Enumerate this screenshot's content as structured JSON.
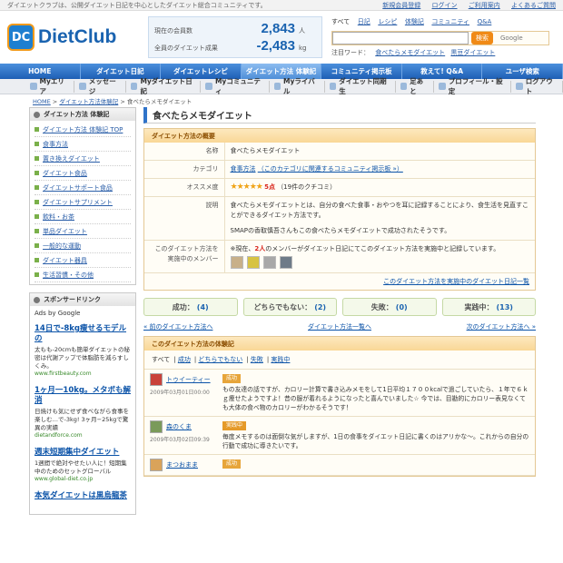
{
  "topbar": {
    "tagline": "ダイエットクラブは、公開ダイエット日記を中心としたダイエット総合コミュニティです。",
    "links": [
      "新規会員登録",
      "ログイン",
      "ご利用案内",
      "よくあるご質問"
    ]
  },
  "logo": {
    "mark": "DC",
    "name": "DietClub"
  },
  "stats": {
    "members_label": "現在の会員数",
    "members_value": "2,843",
    "members_unit": "人",
    "result_label": "全員のダイエット成果",
    "result_value": "-2,483",
    "result_unit": "kg"
  },
  "search": {
    "quick": [
      "すべて",
      "日記",
      "レシピ",
      "体験記",
      "コミュニティ",
      "Q&A"
    ],
    "placeholder": "",
    "button": "検索",
    "google": "Google",
    "popular_label": "注目ワード：",
    "popular": [
      "食べたらメモダイエット",
      "黒豆ダイエット"
    ]
  },
  "mainnav": [
    "HOME",
    "ダイエット日記",
    "ダイエットレシピ",
    "ダイエット方法 体験記",
    "コミュニティ掲示板",
    "教えて! Q&A",
    "ユーザ検索"
  ],
  "subnav": [
    "Myエリア",
    "メッセージ",
    "Myダイエット日記",
    "Myコミュニティ",
    "Myライバル",
    "ダイエット同期生",
    "足あと",
    "プロフィール・設定",
    "ログアウト"
  ],
  "breadcrumb": {
    "home": "HOME",
    "section": "ダイエット方法体験記",
    "current": "食べたらメモダイエット"
  },
  "sidebar": {
    "heading": "ダイエット方法 体験記",
    "items": [
      "ダイエット方法 体験記 TOP",
      "食事方法",
      "置き換えダイエット",
      "ダイエット食品",
      "ダイエットサポート食品",
      "ダイエットサプリメント",
      "飲料・お茶",
      "単品ダイエット",
      "一般的な運動",
      "ダイエット器具",
      "生活習慣・その他"
    ],
    "sponsor_heading": "スポンサードリンク",
    "ads_by": "Ads by Google",
    "ads": [
      {
        "title": "14日で-8kg痩せるモデルの",
        "desc": "太もも-20cmも簡単ダイエットの秘密は代謝アップで体脂肪を減らすしくみ。",
        "url": "www.firstbeauty.com"
      },
      {
        "title": "1ヶ月一10kg。メタボも解消",
        "desc": "日焼けも気にせず食べながら食事を楽しむ…で-3kg! 3ヶ月−25kgで驚異の実績",
        "url": "dietandforce.com"
      },
      {
        "title": "週末短期集中ダイエット",
        "desc": "1週間で絶対やせたい人に！短期集中のためのセットグローバル",
        "url": "www.global-diet.co.jp"
      },
      {
        "title": "本気ダイエットは黒烏龍茶",
        "desc": "",
        "url": ""
      }
    ]
  },
  "page": {
    "title": "食べたらメモダイエット"
  },
  "overview": {
    "heading": "ダイエット方法の概要",
    "name_label": "名称",
    "name": "食べたらメモダイエット",
    "category_label": "カテゴリ",
    "category": "食事方法",
    "category_link": "（このカテゴリに関連するコミュニティ掲示板 »）",
    "rating_label": "オススメ度",
    "stars": "★★★★★",
    "score": "5点",
    "reviews": "（19件のクチコミ）",
    "desc_label": "説明",
    "desc1": "食べたらメモダイエットとは、自分の食べた食事・おやつを耳に記録することにより、食生活を見直すことができるダイエット方法です。",
    "desc2": "SMAPの香取慎吾さんもこの食べたらメモダイエットで成功されたそうです。",
    "members_label": "このダイエット方法を実施中のメンバー",
    "members_pre": "※現在、",
    "members_count": "2人",
    "members_post": "のメンバーがダイエット日記にてこのダイエット方法を実施中と記録しています。",
    "members_link": "このダイエット方法を実施中のダイエット日記一覧"
  },
  "results": [
    {
      "label": "成功：",
      "value": "(4)"
    },
    {
      "label": "どちらでもない：",
      "value": "(2)"
    },
    {
      "label": "失敗：",
      "value": "(0)"
    },
    {
      "label": "実践中：",
      "value": "(13)"
    }
  ],
  "pager": {
    "prev": "« 前のダイエット方法へ",
    "list": "ダイエット方法一覧へ",
    "next": "次のダイエット方法へ »"
  },
  "reviews": {
    "heading": "このダイエット方法の体験記",
    "tabs": [
      "すべて",
      "成功",
      "どちらでもない",
      "失敗",
      "実践中"
    ],
    "posts": [
      {
        "user": "トゥイーティー",
        "date": "2009年03月01日00:00",
        "badge": "成功",
        "body": "もの友達の話ですが、カロリー計算で書き込みメモをして1日平均１７００kcalで過ごしていたら、１年で６ｋｇ痩せたようですよ！昔の服が着れるようになったと喜んでいました☆ 今では、目勘的にカロリー表見なくても大体の食べ物のカロリーがわかるそうです！"
      },
      {
        "user": "森のくま",
        "date": "2009年03月02日09:39",
        "badge": "実践中",
        "body": "毎度メモするのは面倒な気がしますが、1日の食事をダイエット日記に書くのはアリかな～。これからの自分の行動で成功に導きたいです。"
      },
      {
        "user": "まつおまま",
        "date": "",
        "badge": "成功",
        "body": ""
      }
    ]
  }
}
